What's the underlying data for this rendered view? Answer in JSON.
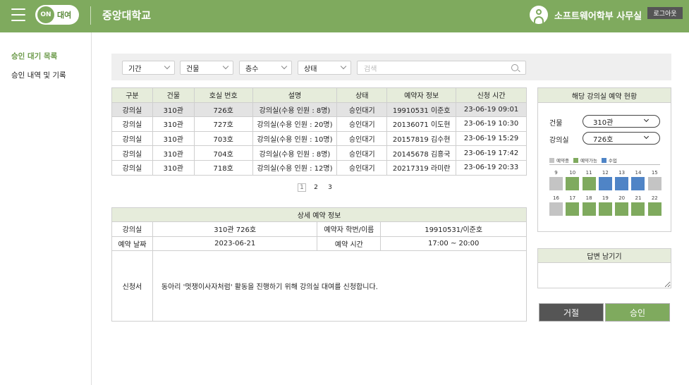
{
  "header": {
    "logo_on": "ON",
    "logo_text": "대여",
    "univ_name": "중앙대학교",
    "user_name": "소프트웨어학부 사무실",
    "logout_label": "로그아웃",
    "bg_color": "#7faa5e"
  },
  "sidebar": {
    "items": [
      {
        "label": "승인 대기 목록",
        "active": true
      },
      {
        "label": "승인 내역 및 기록",
        "active": false
      }
    ]
  },
  "filters": {
    "period": "기간",
    "building": "건물",
    "floor": "층수",
    "status": "상태",
    "search_placeholder": "검색"
  },
  "list": {
    "headers": [
      "구분",
      "건물",
      "호실 번호",
      "설명",
      "상태",
      "예약자 정보",
      "신청 시간"
    ],
    "rows": [
      [
        "강의실",
        "310관",
        "726호",
        "강의실(수용 인원 : 8명)",
        "승인대기",
        "19910531 이준호",
        "23-06-19   09:01"
      ],
      [
        "강의실",
        "310관",
        "727호",
        "강의실(수용 인원 : 20명)",
        "승인대기",
        "20136071 이도현",
        "23-06-19   10:30"
      ],
      [
        "강의실",
        "310관",
        "703호",
        "강의실(수용 인원 : 10명)",
        "승인대기",
        "20157819 김수현",
        "23-06-19   15:29"
      ],
      [
        "강의실",
        "310관",
        "704호",
        "강의실(수용 인원 : 8명)",
        "승인대기",
        "20145678 김흥국",
        "23-06-19   17:42"
      ],
      [
        "강의실",
        "310관",
        "718호",
        "강의실(수용 인원 : 12명)",
        "승인대기",
        "20217319 라미란",
        "23-06-19   20:33"
      ]
    ]
  },
  "pagination": {
    "pages": [
      "1",
      "2",
      "3"
    ],
    "current": "1"
  },
  "detail": {
    "title": "상세 예약 정보",
    "room_label": "강의실",
    "room_value": "310관 726호",
    "booker_label": "예약자 학번/이름",
    "booker_value": "19910531/이준호",
    "date_label": "예약 날짜",
    "date_value": "2023-06-21",
    "time_label": "예약 시간",
    "time_value": "17:00 ~ 20:00",
    "application_label": "신청서",
    "application_text": "동아리 '멋쟁이사자처럼' 활동을 진행하기 위해 강의실 대여를 신청합니다."
  },
  "status_panel": {
    "title": "해당 강의실 예약 현황",
    "building_label": "건물",
    "building_value": "310관",
    "room_label": "강의실",
    "room_value": "726호",
    "legend": [
      {
        "label": "예약중",
        "color": "#c4c4c4"
      },
      {
        "label": "예약가능",
        "color": "#7faa5e"
      },
      {
        "label": "수업",
        "color": "#4f84c6"
      }
    ],
    "week1": [
      {
        "day": "9",
        "state": "reserved"
      },
      {
        "day": "10",
        "state": "available"
      },
      {
        "day": "11",
        "state": "available"
      },
      {
        "day": "12",
        "state": "class"
      },
      {
        "day": "13",
        "state": "class"
      },
      {
        "day": "14",
        "state": "class"
      },
      {
        "day": "15",
        "state": "reserved"
      }
    ],
    "week2": [
      {
        "day": "16",
        "state": "reserved"
      },
      {
        "day": "17",
        "state": "available"
      },
      {
        "day": "18",
        "state": "available"
      },
      {
        "day": "19",
        "state": "available"
      },
      {
        "day": "20",
        "state": "available"
      },
      {
        "day": "21",
        "state": "available"
      },
      {
        "day": "22",
        "state": "available"
      }
    ]
  },
  "answer": {
    "title": "답변 남기기"
  },
  "actions": {
    "reject_label": "거절",
    "approve_label": "승인"
  }
}
